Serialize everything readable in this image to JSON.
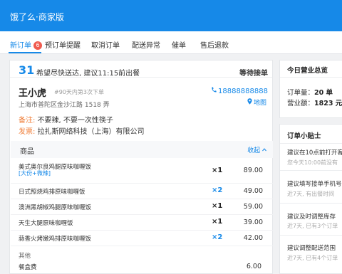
{
  "app": {
    "title": "饿了么·商家版"
  },
  "tabs": [
    {
      "label": "新订单",
      "badge": "6",
      "active": true
    },
    {
      "label": "预订单提醒"
    },
    {
      "label": "取消订单"
    },
    {
      "label": "配送异常"
    },
    {
      "label": "催单"
    },
    {
      "label": "售后退款"
    }
  ],
  "order": {
    "number": "31",
    "hint": "希望尽快送达, 建议11:15前出餐",
    "status": "等待接单",
    "customer_name": "王小虎",
    "customer_note": "#90天内第3次下单",
    "address": "上海市普陀区金沙江路 1518 弄",
    "phone": "18888888888",
    "map_label": "地图",
    "remark_label": "备注:",
    "remark_text": "不要辣, 不要一次性筷子",
    "invoice_label": "发票:",
    "invoice_text": "拉扎斯网络科技（上海）有限公司",
    "goods_title": "商品",
    "collapse_label": "收起",
    "items": [
      {
        "name": "美式奥尔良鸡腿原味咖喱饭",
        "extra": "[大份+微辣]",
        "qty": "×1",
        "price": "89.00"
      },
      {
        "name": "日式照烧鸡排原味咖喱饭",
        "qty": "×2",
        "price": "49.00"
      },
      {
        "name": "澳洲黑胡椒鸡腿原味咖喱饭",
        "qty": "×1",
        "price": "59.00"
      },
      {
        "name": "天生大腿原味咖喱饭",
        "qty": "×1",
        "price": "39.00"
      },
      {
        "name": "蒜香火烤嫩鸡排原味咖喱饭",
        "qty": "×2",
        "price": "42.00"
      }
    ],
    "other_title": "其他",
    "fees": [
      {
        "name": "餐盒费",
        "price": "6.00"
      }
    ]
  },
  "summary": {
    "title": "今日营业总览",
    "order_label": "订单量：",
    "order_value": "20 单",
    "revenue_label": "营业额：",
    "revenue_value": "1823 元"
  },
  "tips": {
    "title": "订单小贴士",
    "items": [
      {
        "title": "建议在10点前打开客户",
        "sub": "您今天10:00前没有"
      },
      {
        "title": "建议填写接单手机号",
        "sub": "近7天, 有出餐时间"
      },
      {
        "title": "建议及时调整库存",
        "sub": "近7天, 已有3个订单"
      },
      {
        "title": "建议调整配送范围",
        "sub": "近7天, 已有4个订单"
      }
    ]
  },
  "colors": {
    "brand": "#1689e8",
    "badge": "#f05b4f",
    "label_orange": "#f0803c"
  },
  "icons": [
    "phone-icon",
    "pin-icon",
    "chevron-up-icon"
  ]
}
